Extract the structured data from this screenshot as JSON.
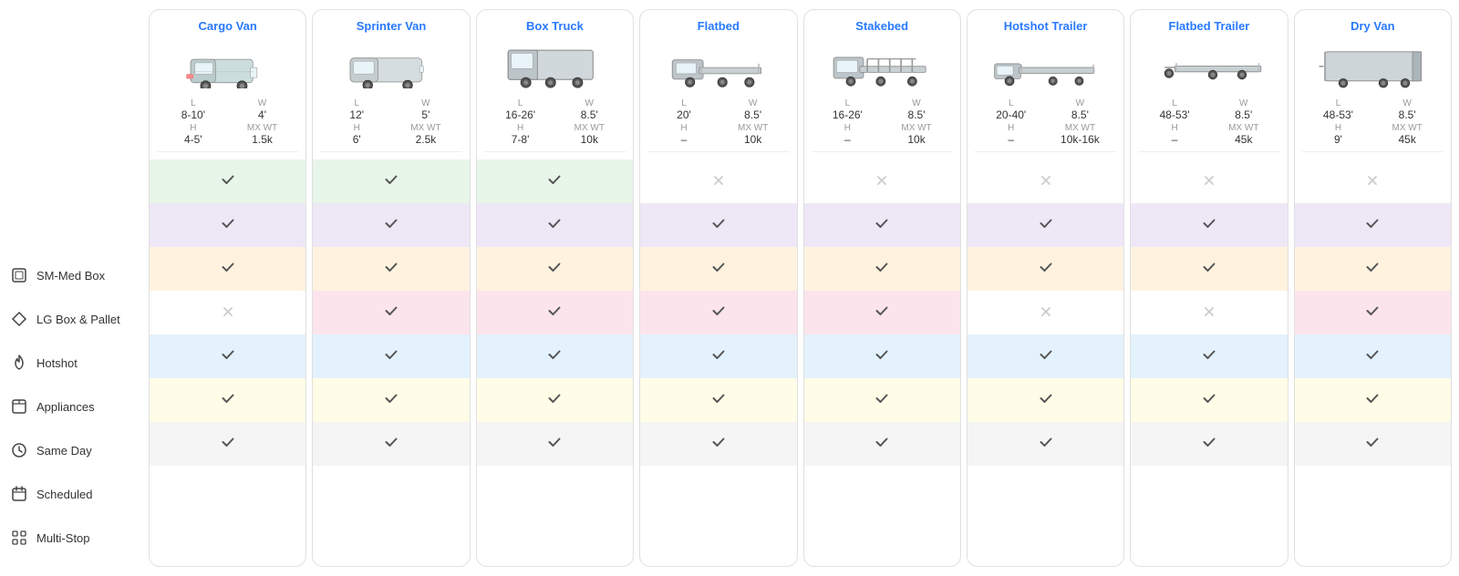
{
  "sidebar": {
    "items": [
      {
        "id": "sm-med-box",
        "label": "SM-Med Box",
        "icon": "box-icon"
      },
      {
        "id": "lg-box-pallet",
        "label": "LG Box & Pallet",
        "icon": "diamond-icon"
      },
      {
        "id": "hotshot",
        "label": "Hotshot",
        "icon": "flame-icon"
      },
      {
        "id": "appliances",
        "label": "Appliances",
        "icon": "calendar-icon"
      },
      {
        "id": "same-day",
        "label": "Same Day",
        "icon": "clock-icon"
      },
      {
        "id": "scheduled",
        "label": "Scheduled",
        "icon": "calendar2-icon"
      },
      {
        "id": "multi-stop",
        "label": "Multi-Stop",
        "icon": "grid-icon"
      }
    ]
  },
  "vehicles": [
    {
      "id": "cargo-van",
      "title": "Cargo Van",
      "specs": {
        "L": "8-10'",
        "W": "4'",
        "H": "4-5'",
        "MX_WT": "1.5k"
      },
      "rows": [
        {
          "type": "check",
          "bg": "green"
        },
        {
          "type": "check",
          "bg": "lavender"
        },
        {
          "type": "check",
          "bg": "peach"
        },
        {
          "type": "x",
          "bg": "white"
        },
        {
          "type": "check",
          "bg": "blue"
        },
        {
          "type": "check",
          "bg": "yellow"
        },
        {
          "type": "check",
          "bg": "gray"
        }
      ]
    },
    {
      "id": "sprinter-van",
      "title": "Sprinter Van",
      "specs": {
        "L": "12'",
        "W": "5'",
        "H": "6'",
        "MX_WT": "2.5k"
      },
      "rows": [
        {
          "type": "check",
          "bg": "green"
        },
        {
          "type": "check",
          "bg": "lavender"
        },
        {
          "type": "check",
          "bg": "peach"
        },
        {
          "type": "check",
          "bg": "pink"
        },
        {
          "type": "check",
          "bg": "blue"
        },
        {
          "type": "check",
          "bg": "yellow"
        },
        {
          "type": "check",
          "bg": "gray"
        }
      ]
    },
    {
      "id": "box-truck",
      "title": "Box Truck",
      "specs": {
        "L": "16-26'",
        "W": "8.5'",
        "H": "7-8'",
        "MX_WT": "10k"
      },
      "rows": [
        {
          "type": "check",
          "bg": "green"
        },
        {
          "type": "check",
          "bg": "lavender"
        },
        {
          "type": "check",
          "bg": "peach"
        },
        {
          "type": "check",
          "bg": "pink"
        },
        {
          "type": "check",
          "bg": "blue"
        },
        {
          "type": "check",
          "bg": "yellow"
        },
        {
          "type": "check",
          "bg": "gray"
        }
      ]
    },
    {
      "id": "flatbed",
      "title": "Flatbed",
      "specs": {
        "L": "20'",
        "W": "8.5'",
        "H": "–",
        "MX_WT": "10k"
      },
      "rows": [
        {
          "type": "x",
          "bg": "white"
        },
        {
          "type": "check",
          "bg": "lavender"
        },
        {
          "type": "check",
          "bg": "peach"
        },
        {
          "type": "check",
          "bg": "pink"
        },
        {
          "type": "check",
          "bg": "blue"
        },
        {
          "type": "check",
          "bg": "yellow"
        },
        {
          "type": "check",
          "bg": "gray"
        }
      ]
    },
    {
      "id": "stakebed",
      "title": "Stakebed",
      "specs": {
        "L": "16-26'",
        "W": "8.5'",
        "H": "–",
        "MX_WT": "10k"
      },
      "rows": [
        {
          "type": "x",
          "bg": "white"
        },
        {
          "type": "check",
          "bg": "lavender"
        },
        {
          "type": "check",
          "bg": "peach"
        },
        {
          "type": "check",
          "bg": "pink"
        },
        {
          "type": "check",
          "bg": "blue"
        },
        {
          "type": "check",
          "bg": "yellow"
        },
        {
          "type": "check",
          "bg": "gray"
        }
      ]
    },
    {
      "id": "hotshot-trailer",
      "title": "Hotshot Trailer",
      "specs": {
        "L": "20-40'",
        "W": "8.5'",
        "H": "–",
        "MX_WT": "10k-16k"
      },
      "rows": [
        {
          "type": "x",
          "bg": "white"
        },
        {
          "type": "check",
          "bg": "lavender"
        },
        {
          "type": "check",
          "bg": "peach"
        },
        {
          "type": "x",
          "bg": "white"
        },
        {
          "type": "check",
          "bg": "blue"
        },
        {
          "type": "check",
          "bg": "yellow"
        },
        {
          "type": "check",
          "bg": "gray"
        }
      ]
    },
    {
      "id": "flatbed-trailer",
      "title": "Flatbed Trailer",
      "specs": {
        "L": "48-53'",
        "W": "8.5'",
        "H": "–",
        "MX_WT": "45k"
      },
      "rows": [
        {
          "type": "x",
          "bg": "white"
        },
        {
          "type": "check",
          "bg": "lavender"
        },
        {
          "type": "check",
          "bg": "peach"
        },
        {
          "type": "x",
          "bg": "white"
        },
        {
          "type": "check",
          "bg": "blue"
        },
        {
          "type": "check",
          "bg": "yellow"
        },
        {
          "type": "check",
          "bg": "gray"
        }
      ]
    },
    {
      "id": "dry-van",
      "title": "Dry Van",
      "specs": {
        "L": "48-53'",
        "W": "8.5'",
        "H": "9'",
        "MX_WT": "45k"
      },
      "rows": [
        {
          "type": "x",
          "bg": "white"
        },
        {
          "type": "check",
          "bg": "lavender"
        },
        {
          "type": "check",
          "bg": "peach"
        },
        {
          "type": "check",
          "bg": "pink"
        },
        {
          "type": "check",
          "bg": "blue"
        },
        {
          "type": "check",
          "bg": "yellow"
        },
        {
          "type": "check",
          "bg": "gray"
        }
      ]
    }
  ]
}
